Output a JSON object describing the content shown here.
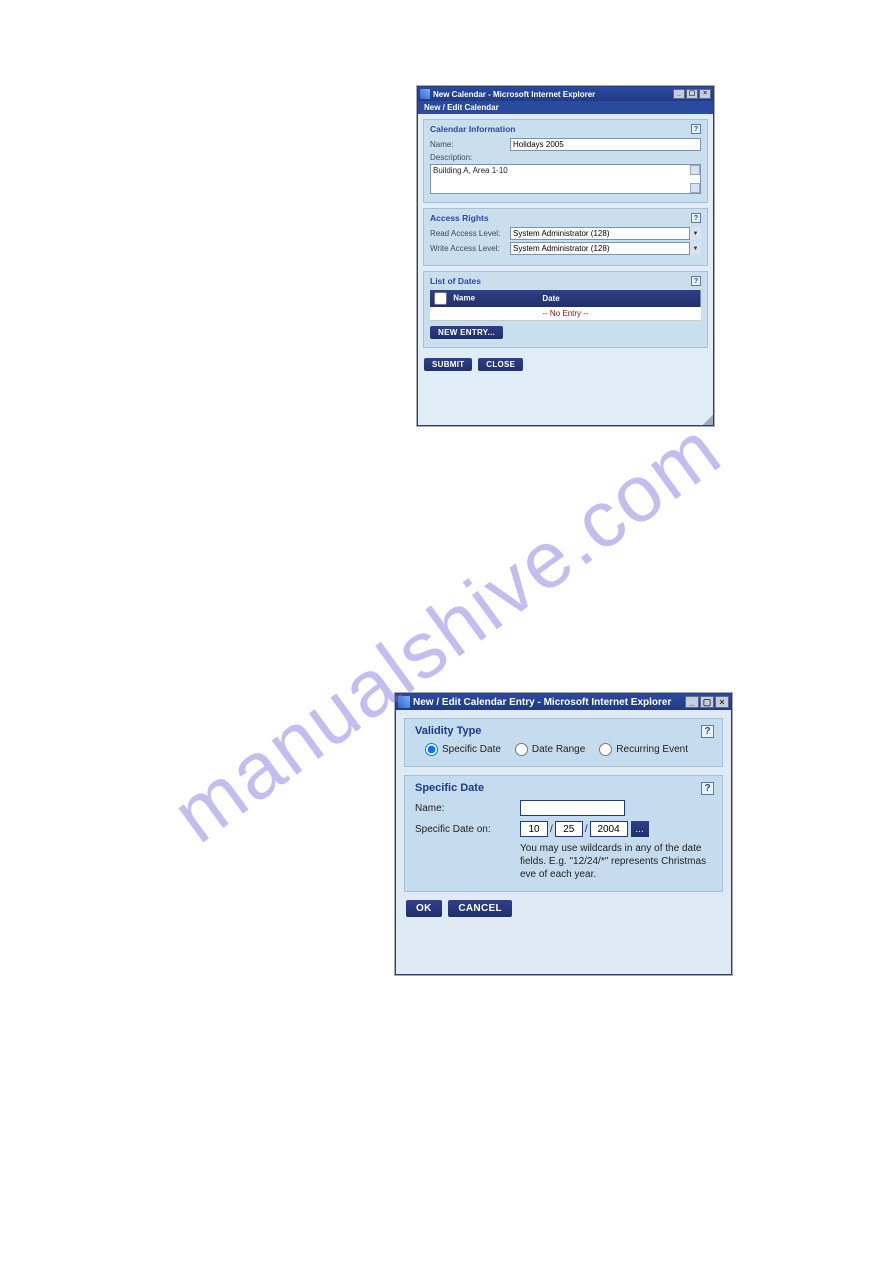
{
  "watermark": "manualshive.com",
  "win1": {
    "title": "New Calendar - Microsoft Internet Explorer",
    "subheader": "New / Edit Calendar",
    "panel_info": {
      "title": "Calendar Information",
      "name_label": "Name:",
      "name_value": "Holidays 2005",
      "desc_label": "Description:",
      "desc_value": "Building A, Area 1-10"
    },
    "panel_access": {
      "title": "Access Rights",
      "read_label": "Read Access Level:",
      "read_value": "System Administrator (128)",
      "write_label": "Write Access Level:",
      "write_value": "System Administrator (128)"
    },
    "panel_list": {
      "title": "List of Dates",
      "col_name": "Name",
      "col_date": "Date",
      "no_entry": "-- No Entry --",
      "new_entry_btn": "NEW ENTRY..."
    },
    "submit_btn": "SUBMIT",
    "close_btn": "CLOSE"
  },
  "win2": {
    "title": "New / Edit Calendar Entry - Microsoft Internet Explorer",
    "panel_validity": {
      "title": "Validity Type",
      "opt_specific": "Specific Date",
      "opt_range": "Date Range",
      "opt_recur": "Recurring Event"
    },
    "panel_specific": {
      "title": "Specific Date",
      "name_label": "Name:",
      "name_value": "",
      "date_label": "Specific Date on:",
      "month": "10",
      "day": "25",
      "year": "2004",
      "date_btn": "...",
      "hint": "You may use wildcards in any of the date fields. E.g. \"12/24/*\" represents Christmas eve of each year."
    },
    "ok_btn": "OK",
    "cancel_btn": "CANCEL"
  }
}
